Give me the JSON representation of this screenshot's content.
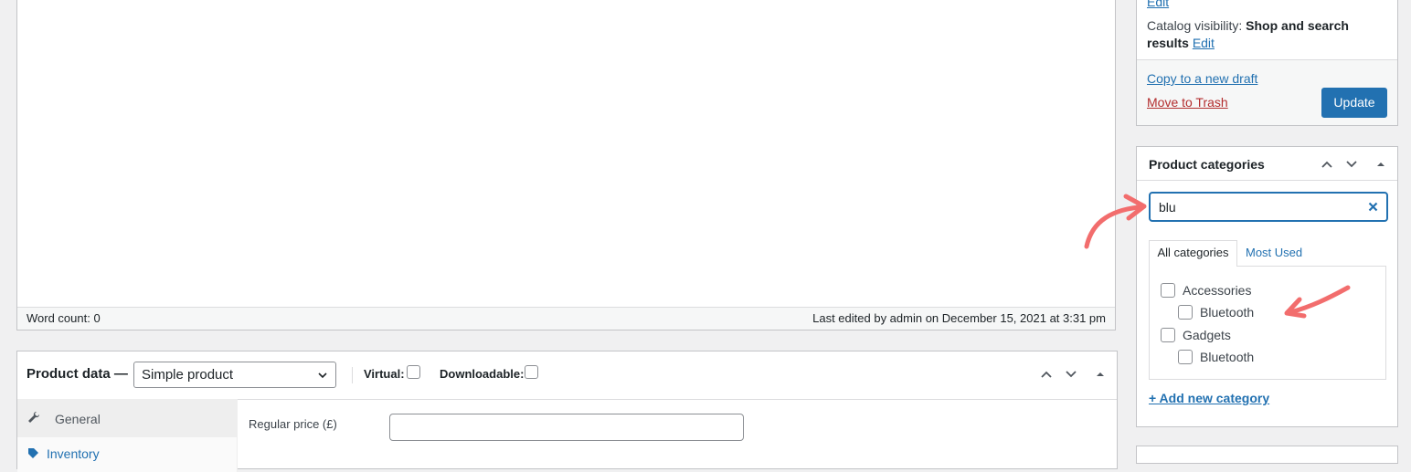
{
  "editor": {
    "word_count": "Word count: 0",
    "last_edited": "Last edited by admin on December 15, 2021 at 3:31 pm"
  },
  "product_data": {
    "title": "Product data —",
    "type_select": "Simple product",
    "virtual_label": "Virtual:",
    "downloadable_label": "Downloadable:",
    "tabs": [
      {
        "label": "General",
        "icon": "wrench-icon"
      },
      {
        "label": "Inventory",
        "icon": "tag-icon"
      }
    ],
    "regular_price_label": "Regular price (£)",
    "regular_price_value": ""
  },
  "publish": {
    "edit_top": "Edit",
    "catalog_visibility_label": "Catalog visibility:",
    "catalog_visibility_value": "Shop and search results",
    "catalog_edit": "Edit",
    "copy_draft": "Copy to a new draft",
    "move_trash": "Move to Trash",
    "update": "Update"
  },
  "categories": {
    "title": "Product categories",
    "search_value": "blu",
    "tabs": [
      "All categories",
      "Most Used"
    ],
    "items": [
      {
        "label": "Accessories",
        "checked": false,
        "level": 0
      },
      {
        "label": "Bluetooth",
        "checked": false,
        "level": 1
      },
      {
        "label": "Gadgets",
        "checked": false,
        "level": 0
      },
      {
        "label": "Bluetooth",
        "checked": false,
        "level": 1
      }
    ],
    "add_new": "+ Add new category"
  },
  "colors": {
    "accent": "#2271b1",
    "danger": "#b32d2e",
    "annotation_arrow": "#f26d6d"
  }
}
